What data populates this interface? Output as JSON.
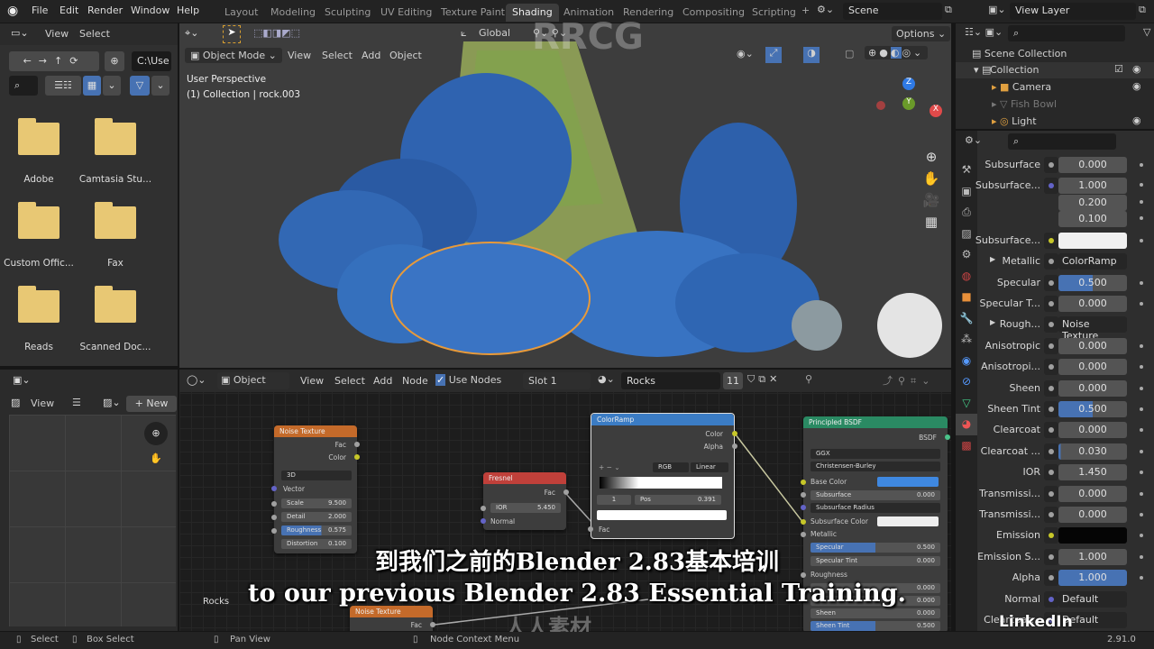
{
  "menu": [
    "File",
    "Edit",
    "Render",
    "Window",
    "Help"
  ],
  "workspaces": [
    "Layout",
    "Modeling",
    "Sculpting",
    "UV Editing",
    "Texture Paint",
    "Shading",
    "Animation",
    "Rendering",
    "Compositing",
    "Scripting"
  ],
  "active_workspace": "Shading",
  "scene": "Scene",
  "view_layer": "View Layer",
  "file_browser": {
    "view": "View",
    "select": "Select",
    "path": "C:\\Use",
    "files": [
      "Adobe",
      "Camtasia Stu...",
      "Custom Offic...",
      "Fax",
      "Reads",
      "Scanned Doc..."
    ]
  },
  "viewport": {
    "mode": "Object Mode",
    "menus": [
      "View",
      "Select",
      "Add",
      "Object"
    ],
    "orientation": "Global",
    "options": "Options",
    "overlay_title": "User Perspective",
    "overlay_sub": "(1) Collection | rock.003",
    "gizmo": {
      "x": "X",
      "y": "Y",
      "z": "Z"
    }
  },
  "outliner": {
    "scene_collection": "Scene Collection",
    "items": [
      {
        "name": "Collection",
        "icon": "collection-icon"
      },
      {
        "name": "Camera",
        "icon": "camera-icon"
      },
      {
        "name": "Fish Bowl",
        "icon": "mesh-icon"
      },
      {
        "name": "Light",
        "icon": "light-icon"
      }
    ]
  },
  "properties": {
    "rows": [
      {
        "label": "Subsurface",
        "value": "0.000",
        "socket": "#a0a0a0"
      },
      {
        "label": "Subsurface...",
        "values": [
          "1.000",
          "0.200",
          "0.100"
        ],
        "socket": "#6363c7"
      },
      {
        "label": "Subsurface...",
        "color": "#f0f0f0",
        "socket": "#c7c729"
      },
      {
        "label": "Metallic",
        "link": "ColorRamp",
        "socket": "#a0a0a0",
        "expand": true
      },
      {
        "label": "Specular",
        "value": "0.500",
        "fill": 0.5,
        "socket": "#a0a0a0"
      },
      {
        "label": "Specular T...",
        "value": "0.000",
        "socket": "#a0a0a0"
      },
      {
        "label": "Rough...",
        "link": "Noise Texture",
        "socket": "#a0a0a0",
        "expand": true
      },
      {
        "label": "Anisotropic",
        "value": "0.000",
        "socket": "#a0a0a0"
      },
      {
        "label": "Anisotropi...",
        "value": "0.000",
        "socket": "#a0a0a0"
      },
      {
        "label": "Sheen",
        "value": "0.000",
        "socket": "#a0a0a0"
      },
      {
        "label": "Sheen Tint",
        "value": "0.500",
        "fill": 0.5,
        "socket": "#a0a0a0"
      },
      {
        "label": "Clearcoat",
        "value": "0.000",
        "socket": "#a0a0a0"
      },
      {
        "label": "Clearcoat ...",
        "value": "0.030",
        "fill": 0.03,
        "socket": "#a0a0a0"
      },
      {
        "label": "IOR",
        "value": "1.450",
        "socket": "#a0a0a0"
      },
      {
        "label": "Transmissi...",
        "value": "0.000",
        "socket": "#a0a0a0"
      },
      {
        "label": "Transmissi...",
        "value": "0.000",
        "socket": "#a0a0a0"
      },
      {
        "label": "Emission",
        "color": "#050505",
        "socket": "#c7c729"
      },
      {
        "label": "Emission S...",
        "value": "1.000",
        "socket": "#a0a0a0"
      },
      {
        "label": "Alpha",
        "value": "1.000",
        "fill": 1.0,
        "socket": "#a0a0a0"
      },
      {
        "label": "Normal",
        "link": "Default",
        "socket": "#6363c7"
      },
      {
        "label": "Clearcoat...",
        "link": "Default",
        "socket": "#6363c7"
      }
    ],
    "version": "2.91.0"
  },
  "image_editor": {
    "view": "View",
    "new": "New"
  },
  "node_editor": {
    "object": "Object",
    "menus": [
      "View",
      "Select",
      "Add",
      "Node"
    ],
    "use_nodes": "Use Nodes",
    "slot": "Slot 1",
    "material": "Rocks",
    "users": "11",
    "frame_label": "Rocks",
    "noise": {
      "title": "Noise Texture",
      "fac": "Fac",
      "color": "Color",
      "dim": "3D",
      "vector": "Vector",
      "scale": [
        "Scale",
        "9.500"
      ],
      "detail": [
        "Detail",
        "2.000"
      ],
      "roughness": [
        "Roughness",
        "0.575"
      ],
      "distortion": [
        "Distortion",
        "0.100"
      ]
    },
    "fresnel": {
      "title": "Fresnel",
      "fac": "Fac",
      "ior": [
        "IOR",
        "5.450"
      ],
      "normal": "Normal"
    },
    "colorramp": {
      "title": "ColorRamp",
      "color": "Color",
      "alpha": "Alpha",
      "mode": "RGB",
      "interp": "Linear",
      "index": "1",
      "pos": [
        "Pos",
        "0.391"
      ],
      "fac": "Fac"
    },
    "bsdf": {
      "title": "Principled BSDF",
      "out": "BSDF",
      "dist": "GGX",
      "sss": "Christensen-Burley",
      "base": "Base Color",
      "subsurface": [
        "Subsurface",
        "0.000"
      ],
      "radius": "Subsurface Radius",
      "sscolor": "Subsurface Color",
      "metallic": "Metallic",
      "specular": [
        "Specular",
        "0.500"
      ],
      "spectint": [
        "Specular Tint",
        "0.000"
      ],
      "roughness": "Roughness",
      "r1": "0.000",
      "r2": "0.000",
      "sheen": [
        "Sheen",
        "0.000"
      ],
      "sheentint": [
        "Sheen Tint",
        "0.500"
      ]
    },
    "noise2": {
      "title": "Noise Texture",
      "fac": "Fac"
    }
  },
  "subtitles": {
    "zh": "到我们之前的Blender 2.83基本培训",
    "en": "to our previous Blender 2.83 Essential Training."
  },
  "watermarks": {
    "linkedin": "LinkedIn Learning",
    "rrcg": "RRCG",
    "site": "人人素材"
  },
  "statusbar": {
    "select": "Select",
    "box_select": "Box Select",
    "pan": "Pan View",
    "context": "Node Context Menu"
  },
  "colors": {
    "accent": "#4772b3",
    "noise_header": "#c46a2a",
    "fresnel_header": "#c0403a",
    "ramp_header": "#3b7cc4",
    "bsdf_header": "#2a8a63",
    "rock_blue": "#2f63b0"
  }
}
